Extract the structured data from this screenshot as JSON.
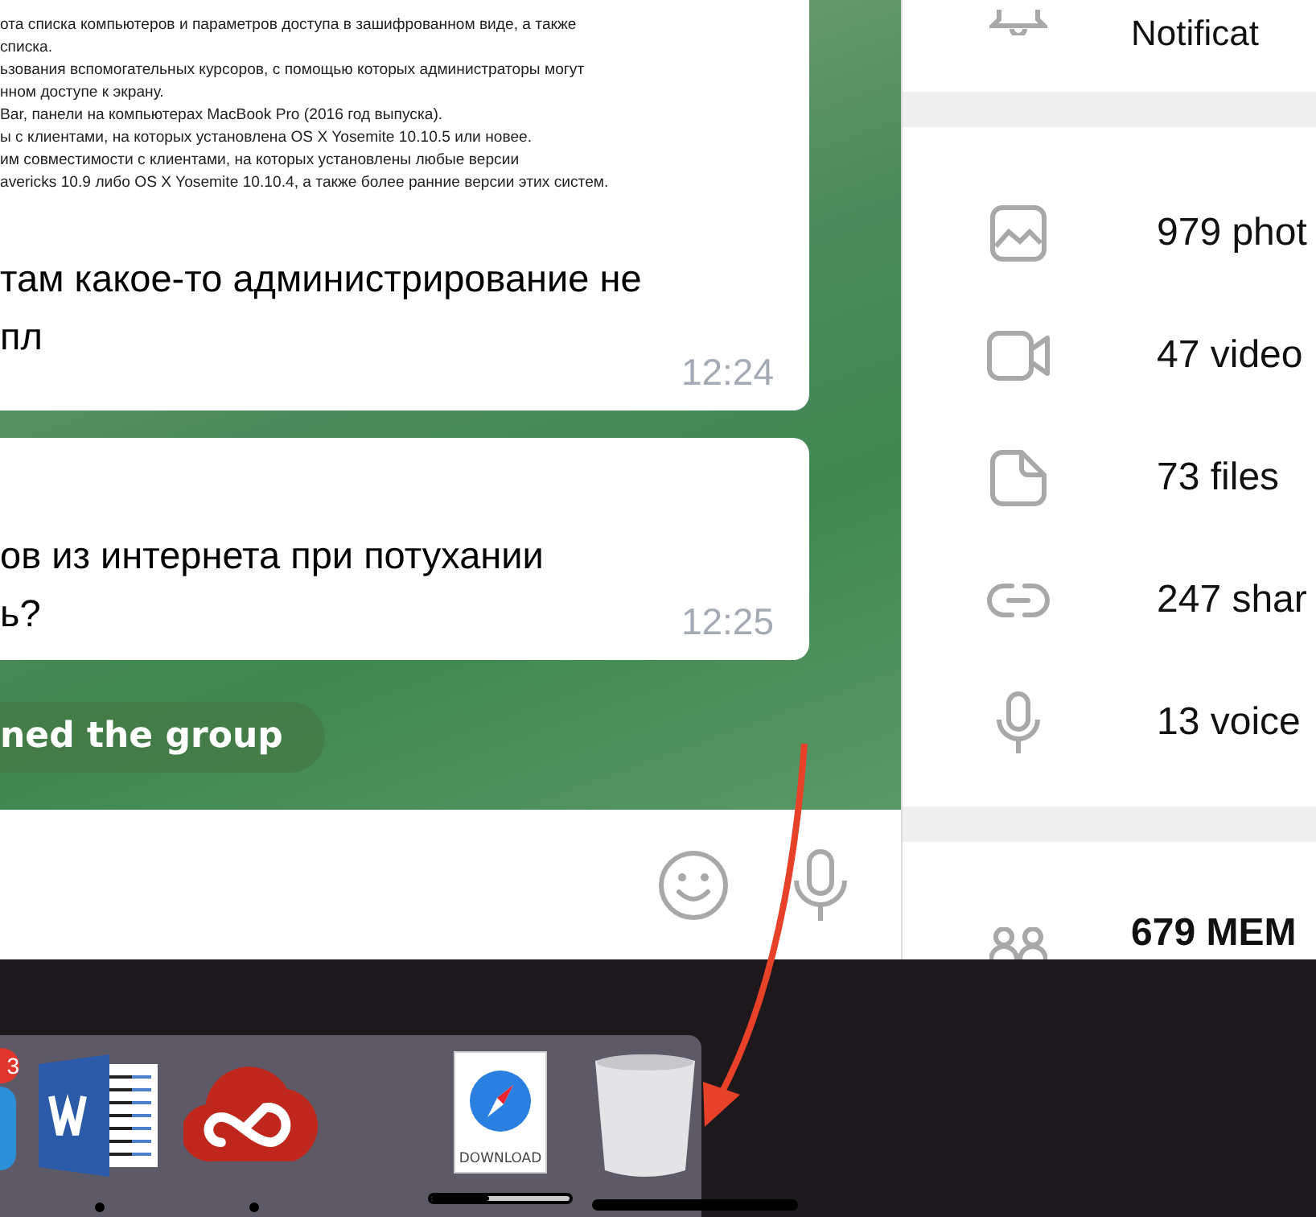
{
  "chat": {
    "messages": [
      {
        "kind": "document",
        "doc_lines": [
          "ота списка компьютеров и параметров доступа в зашифрованном виде, а также",
          "списка.",
          "ьзования вспомогательных курсоров, с помощью которых администраторы могут",
          "нном доступе к экрану.",
          "Bar, панели на компьютерах MacBook Pro (2016 год выпуска).",
          "ы с клиентами, на которых установлена OS X Yosemite 10.10.5 или новее.",
          "им совместимости с клиентами, на которых установлены любые версии",
          "avericks 10.9 либо OS X Yosemite 10.10.4, а также более ранние версии этих систем."
        ],
        "text_lines": [
          "там какое-то администрирование не",
          "пл"
        ],
        "time": "12:24"
      },
      {
        "kind": "text",
        "text_lines": [
          "ов из интернета при потухании",
          "ь?"
        ],
        "time": "12:25"
      }
    ],
    "service_message": "ned the group"
  },
  "info_panel": {
    "notifications_label": "Notificat",
    "media": [
      {
        "kind": "photo",
        "label": "979 phot"
      },
      {
        "kind": "video",
        "label": "47 video"
      },
      {
        "kind": "file",
        "label": "73 files"
      },
      {
        "kind": "link",
        "label": "247 shar"
      },
      {
        "kind": "voice",
        "label": "13 voice"
      }
    ],
    "members_label": "679 MEM"
  },
  "dock": {
    "apps": [
      {
        "kind": "partial",
        "badge": "3"
      },
      {
        "kind": "word",
        "running": true
      },
      {
        "kind": "cloud",
        "running": true
      }
    ],
    "stack": {
      "label": "DOWNLOAD",
      "level": 0.42
    },
    "trash": {
      "level": 1
    }
  }
}
